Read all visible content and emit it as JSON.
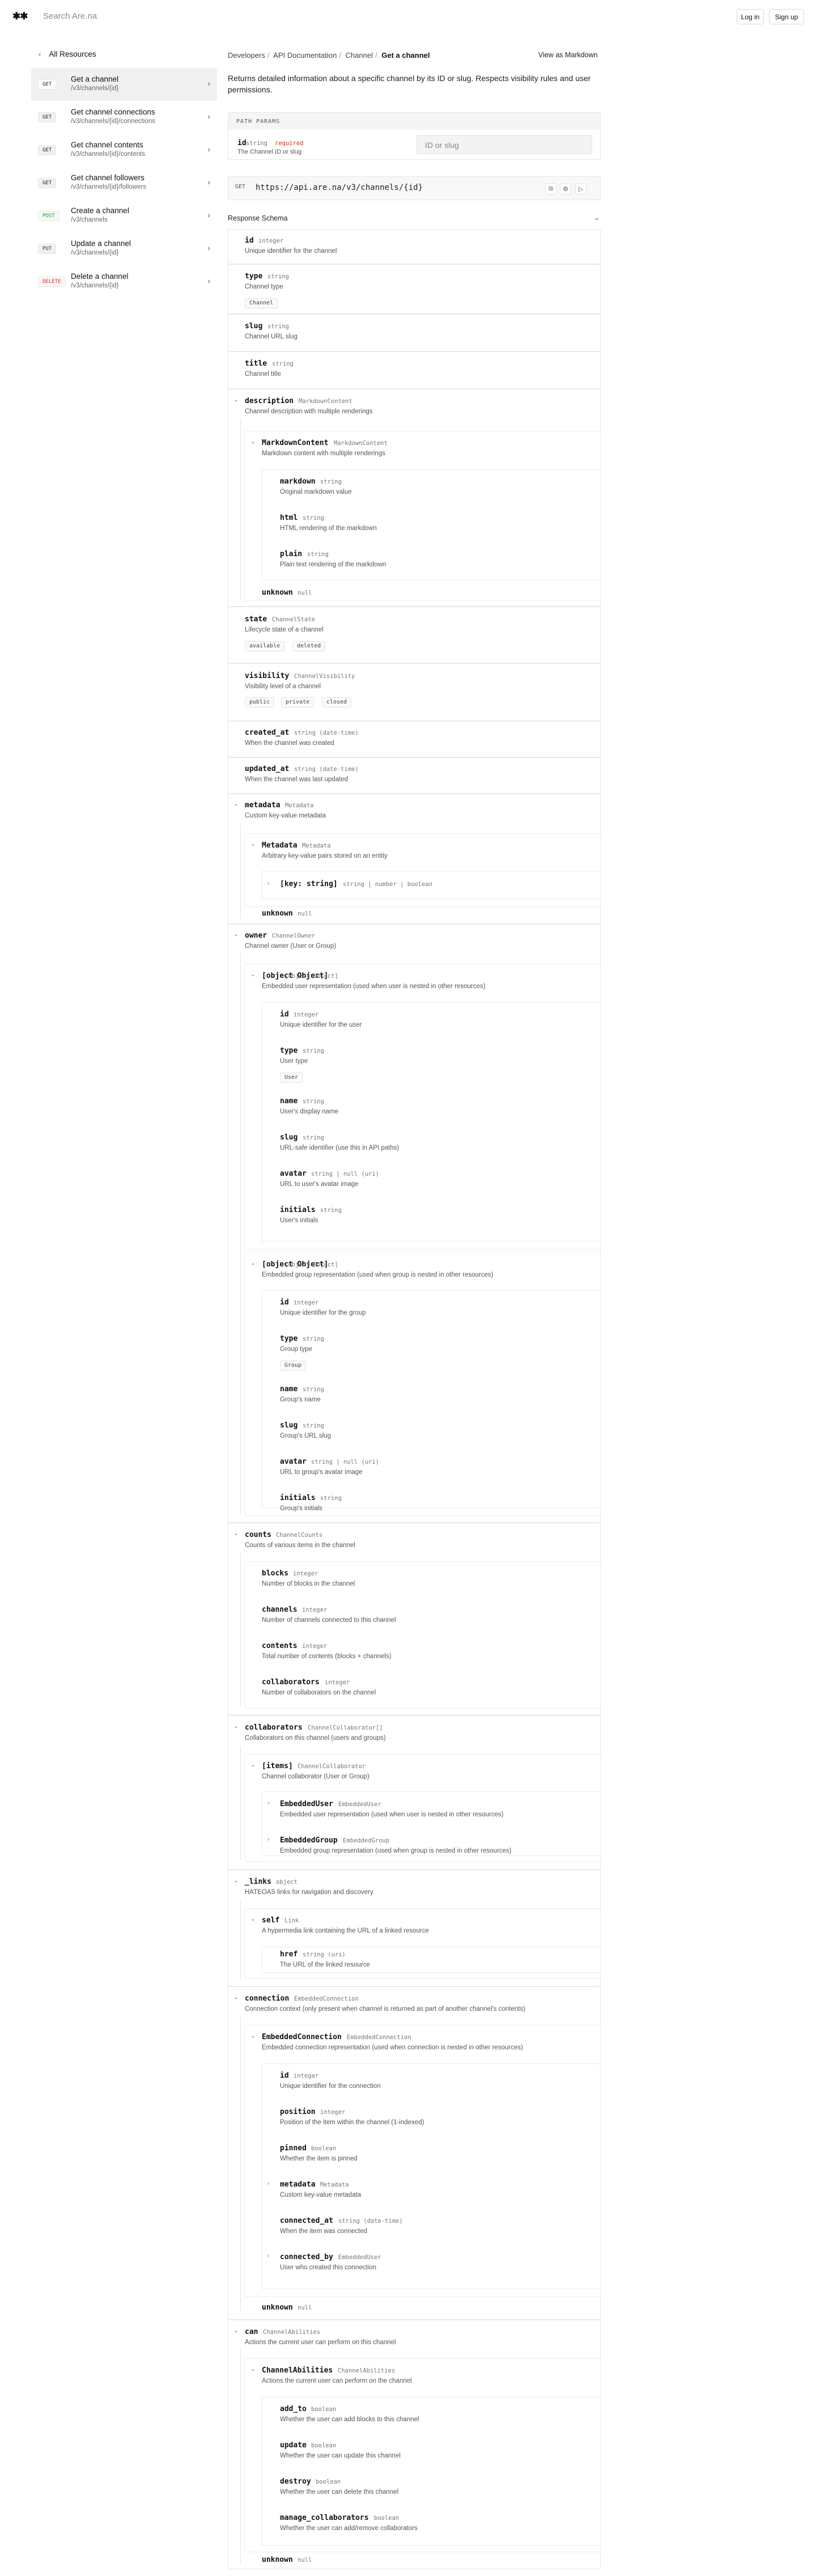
{
  "header": {
    "logo": "✱✱",
    "search_placeholder": "Search Are.na",
    "login_label": "Log in",
    "signup_label": "Sign up"
  },
  "sidebar": {
    "back_label": "All Resources",
    "endpoints": [
      {
        "method": "GET",
        "title": "Get a channel",
        "path": "/v3/channels/{id}"
      },
      {
        "method": "GET",
        "title": "Get channel connections",
        "path": "/v3/channels/{id}/connections"
      },
      {
        "method": "GET",
        "title": "Get channel contents",
        "path": "/v3/channels/{id}/contents"
      },
      {
        "method": "GET",
        "title": "Get channel followers",
        "path": "/v3/channels/{id}/followers"
      },
      {
        "method": "POST",
        "title": "Create a channel",
        "path": "/v3/channels"
      },
      {
        "method": "PUT",
        "title": "Update a channel",
        "path": "/v3/channels/{id}"
      },
      {
        "method": "DELETE",
        "title": "Delete a channel",
        "path": "/v3/channels/{id}"
      }
    ]
  },
  "main": {
    "breadcrumb": [
      "Developers",
      "API Documentation",
      "Channel",
      "Get a channel"
    ],
    "view_markdown": "View as Markdown",
    "description": "Returns detailed information about a specific channel by its ID or slug. Respects visibility rules and user permissions.",
    "path_params": {
      "title": "PATH PARAMS",
      "name": "id",
      "type": "string",
      "required": "required",
      "desc": "The Channel ID or slug",
      "input_placeholder": "ID or slug"
    },
    "url": {
      "method": "GET",
      "text": "https://api.are.na/v3/channels/{id}"
    },
    "response_schema": "Response Schema"
  },
  "schema": {
    "id": {
      "name": "id",
      "type": "integer",
      "desc": "Unique identifier for the channel"
    },
    "type": {
      "name": "type",
      "type": "string",
      "desc": "Channel type",
      "enum": [
        "Channel"
      ]
    },
    "slug": {
      "name": "slug",
      "type": "string",
      "desc": "Channel URL slug"
    },
    "title": {
      "name": "title",
      "type": "string",
      "desc": "Channel title"
    },
    "description": {
      "name": "description",
      "type": "MarkdownContent",
      "desc": "Channel description with multiple renderings",
      "inner": {
        "name": "MarkdownContent",
        "type": "MarkdownContent",
        "desc": "Markdown content with multiple renderings",
        "markdown": {
          "name": "markdown",
          "type": "string",
          "desc": "Original markdown value"
        },
        "html": {
          "name": "html",
          "type": "string",
          "desc": "HTML rendering of the markdown"
        },
        "plain": {
          "name": "plain",
          "type": "string",
          "desc": "Plain text rendering of the markdown"
        }
      },
      "unknown": {
        "name": "unknown",
        "type": "null"
      }
    },
    "state": {
      "name": "state",
      "type": "ChannelState",
      "desc": "Lifecycle state of a channel",
      "enum": [
        "available",
        "deleted"
      ]
    },
    "visibility": {
      "name": "visibility",
      "type": "ChannelVisibility",
      "desc": "Visibility level of a channel",
      "enum": [
        "public",
        "private",
        "closed"
      ]
    },
    "created_at": {
      "name": "created_at",
      "type": "string (date-time)",
      "desc": "When the channel was created"
    },
    "updated_at": {
      "name": "updated_at",
      "type": "string (date-time)",
      "desc": "When the channel was last updated"
    },
    "metadata": {
      "name": "metadata",
      "type": "Metadata",
      "desc": "Custom key-value metadata",
      "inner": {
        "name": "Metadata",
        "type": "Metadata",
        "desc": "Arbitrary key-value pairs stored on an entity",
        "key": {
          "name": "[key: string]",
          "type": "string | number | boolean"
        }
      },
      "unknown": {
        "name": "unknown",
        "type": "null"
      }
    },
    "owner": {
      "name": "owner",
      "type": "ChannelOwner",
      "desc": "Channel owner (User or Group)",
      "user": {
        "name": {
          "name": "name",
          "type": "string",
          "desc": "User's display name"
        },
        "type": {
          "name": "type",
          "type": "string",
          "desc": "User type",
          "enum": [
            "User"
          ]
        },
        "desc": "Embedded user representation (used when user is nested in other resources)",
        "id": {
          "name": "id",
          "type": "integer",
          "desc": "Unique identifier for the user"
        },
        "slug": {
          "name": "slug",
          "type": "string",
          "desc": "URL-safe identifier (use this in API paths)"
        },
        "avatar": {
          "name": "avatar",
          "type": "string | null (uri)",
          "desc": "URL to user's avatar image"
        },
        "initials": {
          "name": "initials",
          "type": "string",
          "desc": "User's initials"
        }
      },
      "group": {
        "name": {
          "name": "name",
          "type": "string",
          "desc": "Group's name"
        },
        "type": {
          "name": "type",
          "type": "string",
          "desc": "Group type",
          "enum": [
            "Group"
          ]
        },
        "desc": "Embedded group representation (used when group is nested in other resources)",
        "id": {
          "name": "id",
          "type": "integer",
          "desc": "Unique identifier for the group"
        },
        "slug": {
          "name": "slug",
          "type": "string",
          "desc": "Group's URL slug"
        },
        "avatar": {
          "name": "avatar",
          "type": "string | null (uri)",
          "desc": "URL to group's avatar image"
        },
        "initials": {
          "name": "initials",
          "type": "string",
          "desc": "Group's initials"
        }
      }
    },
    "counts": {
      "name": "counts",
      "type": "ChannelCounts",
      "desc": "Counts of various items in the channel",
      "blocks": {
        "name": "blocks",
        "type": "integer",
        "desc": "Number of blocks in the channel"
      },
      "channels": {
        "name": "channels",
        "type": "integer",
        "desc": "Number of channels connected to this channel"
      },
      "contents": {
        "name": "contents",
        "type": "integer",
        "desc": "Total number of contents (blocks + channels)"
      },
      "collaborators": {
        "name": "collaborators",
        "type": "integer",
        "desc": "Number of collaborators on the channel"
      }
    },
    "collaborators": {
      "name": "collaborators",
      "type": "ChannelCollaborator[]",
      "desc": "Collaborators on this channel (users and groups)",
      "items": {
        "name": "[items]",
        "type": "ChannelCollaborator",
        "desc": "Channel collaborator (User or Group)",
        "user": {
          "name": "EmbeddedUser",
          "type": "EmbeddedUser",
          "desc": "Embedded user representation (used when user is nested in other resources)"
        },
        "group": {
          "name": "EmbeddedGroup",
          "type": "EmbeddedGroup",
          "desc": "Embedded group representation (used when group is nested in other resources)"
        }
      }
    },
    "links": {
      "name": "_links",
      "type": "object",
      "desc": "HATEOAS links for navigation and discovery",
      "self": {
        "name": "self",
        "type": "Link",
        "desc": "A hypermedia link containing the URL of a linked resource",
        "href": {
          "name": "href",
          "type": "string (uri)",
          "desc": "The URL of the linked resource"
        }
      }
    },
    "connection": {
      "name": "connection",
      "type": "EmbeddedConnection",
      "desc": "Connection context (only present when channel is returned as part of another channel's contents)",
      "inner": {
        "name": "EmbeddedConnection",
        "type": "EmbeddedConnection",
        "desc": "Embedded connection representation (used when connection is nested in other resources)",
        "id": {
          "name": "id",
          "type": "integer",
          "desc": "Unique identifier for the connection"
        },
        "position": {
          "name": "position",
          "type": "integer",
          "desc": "Position of the item within the channel (1-indexed)"
        },
        "pinned": {
          "name": "pinned",
          "type": "boolean",
          "desc": "Whether the item is pinned"
        },
        "metadata": {
          "name": "metadata",
          "type": "Metadata",
          "desc": "Custom key-value metadata"
        },
        "connected_at": {
          "name": "connected_at",
          "type": "string (date-time)",
          "desc": "When the item was connected"
        },
        "connected_by": {
          "name": "connected_by",
          "type": "EmbeddedUser",
          "desc": "User who created this connection"
        }
      },
      "unknown": {
        "name": "unknown",
        "type": "null"
      }
    },
    "can": {
      "name": "can",
      "type": "ChannelAbilities",
      "desc": "Actions the current user can perform on this channel",
      "inner": {
        "name": "ChannelAbilities",
        "type": "ChannelAbilities",
        "desc": "Actions the current user can perform on the channel",
        "add_to": {
          "name": "add_to",
          "type": "boolean",
          "desc": "Whether the user can add blocks to this channel"
        },
        "update": {
          "name": "update",
          "type": "boolean",
          "desc": "Whether the user can update this channel"
        },
        "destroy": {
          "name": "destroy",
          "type": "boolean",
          "desc": "Whether the user can delete this channel"
        },
        "manage_collaborators": {
          "name": "manage_collaborators",
          "type": "boolean",
          "desc": "Whether the user can add/remove collaborators"
        }
      },
      "unknown": {
        "name": "unknown",
        "type": "null"
      }
    }
  }
}
